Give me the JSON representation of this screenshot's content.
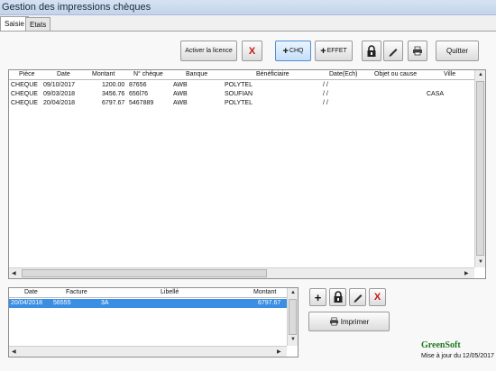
{
  "window": {
    "title": "Gestion des impressions chèques"
  },
  "tabs": [
    {
      "label": "Saisie"
    },
    {
      "label": "Etats"
    }
  ],
  "toolbar": {
    "license_label": "Activer la licence",
    "delete_label": "X",
    "add_chq_label": "CHQ",
    "add_effet_label": "EFFET",
    "quit_label": "Quitter"
  },
  "cheques": {
    "columns": [
      "Pièce",
      "Date",
      "Montant",
      "N° chèque",
      "Banque",
      "Bénéficiaire",
      "Date(Ech)",
      "Objet ou cause",
      "Ville"
    ],
    "rows": [
      [
        "CHEQUE",
        "09/10/2017",
        "1200.00",
        "87656",
        "AWB",
        "POLYTEL",
        "/ /",
        "",
        ""
      ],
      [
        "CHEQUE",
        "09/03/2018",
        "3456.76",
        "656l76",
        "AWB",
        "SOUFIAN",
        "/ /",
        "",
        "CASA"
      ],
      [
        "CHEQUE",
        "20/04/2018",
        "6797.67",
        "5467889",
        "AWB",
        "POLYTEL",
        "/ /",
        "",
        ""
      ]
    ]
  },
  "details": {
    "columns": [
      "Date",
      "Facture",
      "Libellé",
      "Montant"
    ],
    "rows": [
      [
        "20/04/2018",
        "56555",
        "3A",
        "6797.67"
      ]
    ]
  },
  "detail_actions": {
    "add": "+",
    "delete": "X",
    "print_label": "Imprimer"
  },
  "footer": {
    "brand": "GreenSoft",
    "updated": "Mise à jour du 12/05/2017"
  },
  "colors": {
    "selection": "#3a8fe4",
    "brand": "#1f7a1f",
    "delete": "#c51818"
  }
}
